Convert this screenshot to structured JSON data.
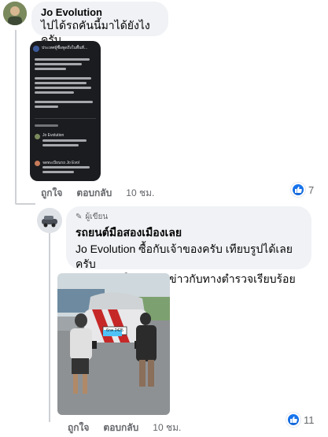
{
  "comment1": {
    "author": "Jo Evolution",
    "text": "ไปได้รถคันนี้มาได้ยังไงครับ",
    "actions": {
      "like": "ถูกใจ",
      "reply": "ตอบกลับ",
      "time": "10 ชม."
    },
    "reaction_count": "7",
    "screenshot": {
      "header": "ประเทศผู้ซื้อพูดถึงในพื้นที่...",
      "reply_name": "Jo Evolution",
      "reply_name2": "จดทะเบียนรถ Jo Evol"
    }
  },
  "comment2": {
    "badge": "ผู้เขียน",
    "author": "รถยนต์มือสองเมืองเลย",
    "text_line1_name": "Jo Evolution",
    "text_line1": " ซื้อกับเจ้าของครับ เทียบรูปได้เลยครับ",
    "text_line2": "เอกสารส่งให้ทางนักข่าวกับทางตำรวจเรียบร้อยครับผม",
    "actions": {
      "like": "ถูกใจ",
      "reply": "ตอบกลับ",
      "time": "10 ชม."
    },
    "reaction_count": "11",
    "photo": {
      "plate": "6กค 2425"
    }
  },
  "colors": {
    "accent": "#1877f2",
    "bubble": "#f0f2f5",
    "secondary_text": "#65676b"
  }
}
